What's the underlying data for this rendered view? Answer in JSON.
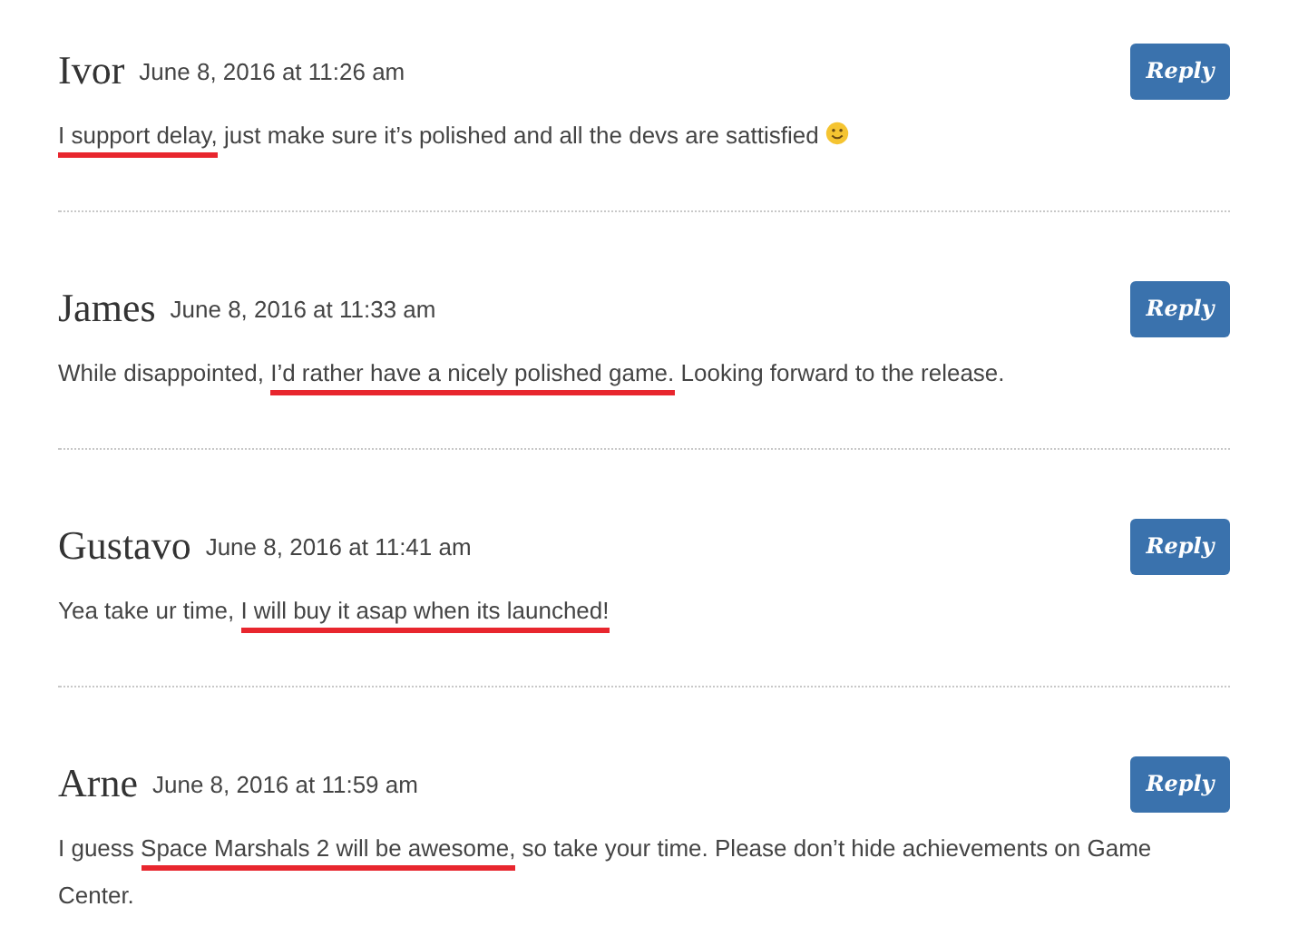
{
  "comments": [
    {
      "author": "Ivor",
      "date": "June 8, 2016 at 11:26 am",
      "reply": "Reply",
      "emoji": true,
      "body": [
        {
          "text": "I support delay,",
          "underlined": true
        },
        {
          "text": " just make sure it’s polished and all the devs are sattisfied",
          "underlined": false
        }
      ]
    },
    {
      "author": "James",
      "date": "June 8, 2016 at 11:33 am",
      "reply": "Reply",
      "emoji": false,
      "body": [
        {
          "text": "While disappointed, ",
          "underlined": false
        },
        {
          "text": "I’d rather have a nicely polished game.",
          "underlined": true
        },
        {
          "text": " Looking forward to the release.",
          "underlined": false
        }
      ]
    },
    {
      "author": "Gustavo",
      "date": "June 8, 2016 at 11:41 am",
      "reply": "Reply",
      "emoji": false,
      "body": [
        {
          "text": "Yea take ur time, ",
          "underlined": false
        },
        {
          "text": "I will buy it asap when its launched!",
          "underlined": true
        }
      ]
    },
    {
      "author": "Arne",
      "date": "June 8, 2016 at 11:59 am",
      "reply": "Reply",
      "emoji": false,
      "body": [
        {
          "text": "I guess ",
          "underlined": false
        },
        {
          "text": "Space Marshals 2 will be awesome,",
          "underlined": true
        },
        {
          "text": " so take your time. Please don’t hide achievements on Game Center.",
          "underlined": false
        }
      ]
    }
  ]
}
